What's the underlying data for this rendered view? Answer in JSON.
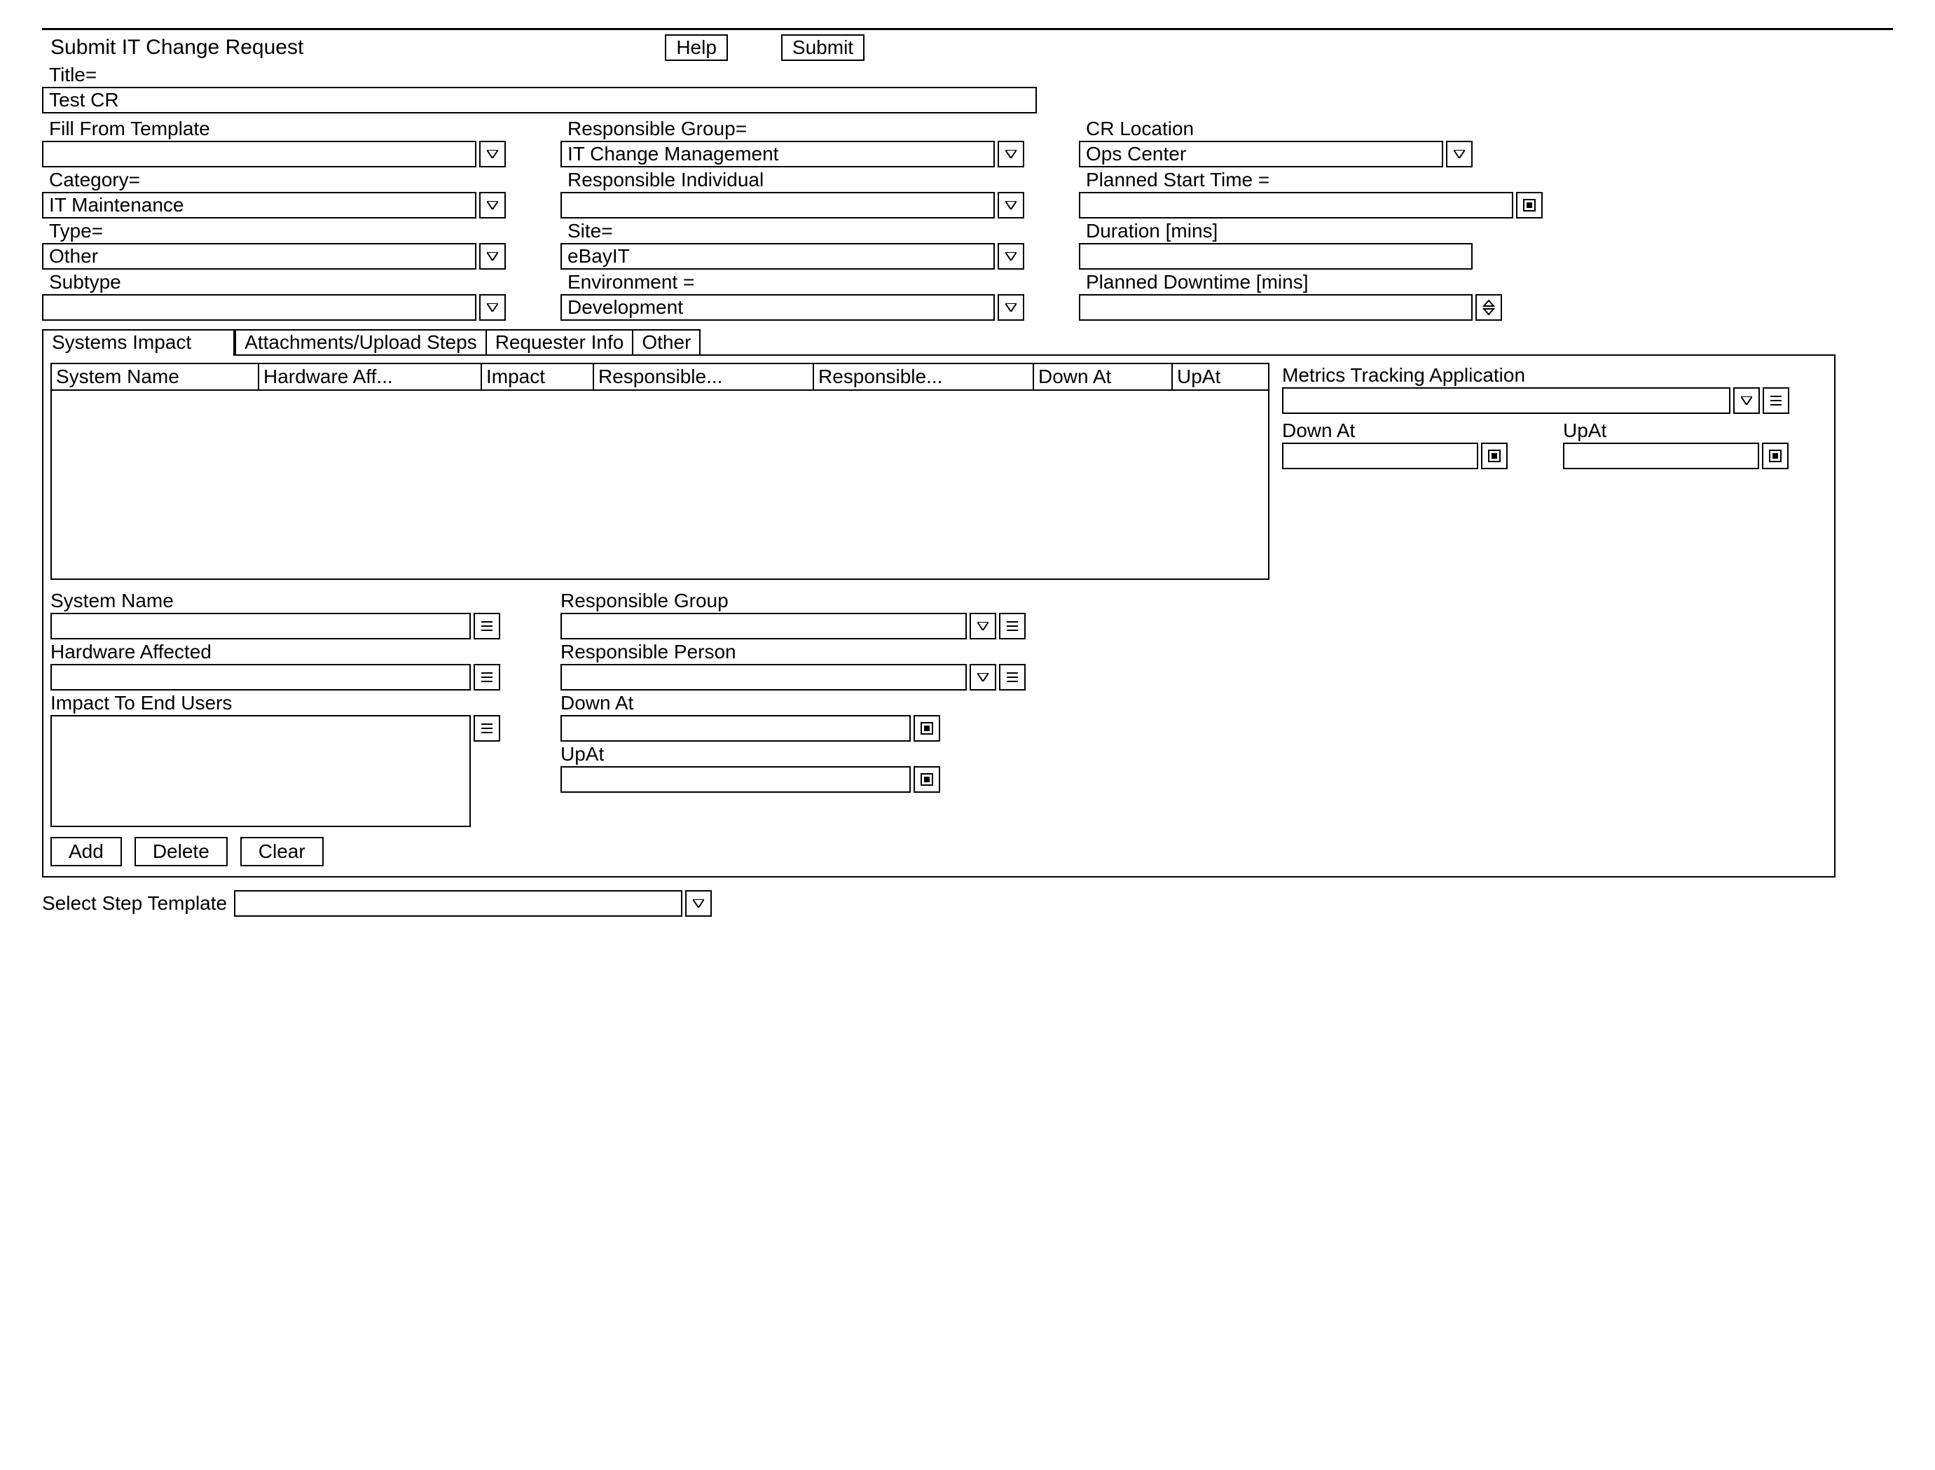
{
  "header": {
    "title": "Submit IT Change Request",
    "help_label": "Help",
    "submit_label": "Submit"
  },
  "title": {
    "label": "Title=",
    "value": "Test CR"
  },
  "col1": {
    "fill_template_label": "Fill From Template",
    "fill_template_value": "",
    "category_label": "Category=",
    "category_value": "IT Maintenance",
    "type_label": "Type=",
    "type_value": "Other",
    "subtype_label": "Subtype",
    "subtype_value": ""
  },
  "col2": {
    "resp_group_label": "Responsible Group=",
    "resp_group_value": "IT Change Management",
    "resp_indiv_label": "Responsible Individual",
    "resp_indiv_value": "",
    "site_label": "Site=",
    "site_value": "eBayIT",
    "env_label": "Environment =",
    "env_value": "Development"
  },
  "col3": {
    "cr_loc_label": "CR Location",
    "cr_loc_value": "Ops Center",
    "planned_start_label": "Planned Start Time =",
    "planned_start_value": "",
    "duration_label": "Duration [mins]",
    "duration_value": "",
    "planned_down_label": "Planned Downtime [mins]",
    "planned_down_value": ""
  },
  "tabs": {
    "t1": "Systems Impact",
    "t2": "Attachments/Upload Steps",
    "t3": "Requester Info",
    "t4": "Other"
  },
  "table_headers": {
    "h1": "System Name",
    "h2": "Hardware Aff...",
    "h3": "Impact",
    "h4": "Responsible...",
    "h5": "Responsible...",
    "h6": "Down At",
    "h7": "UpAt"
  },
  "metrics": {
    "label": "Metrics Tracking Application",
    "value": "",
    "down_at_label": "Down At",
    "down_at_value": "",
    "up_at_label": "UpAt",
    "up_at_value": ""
  },
  "detail": {
    "system_name_label": "System Name",
    "system_name_value": "",
    "hw_aff_label": "Hardware Affected",
    "hw_aff_value": "",
    "impact_label": "Impact To End Users",
    "impact_value": "",
    "resp_group_label": "Responsible Group",
    "resp_group_value": "",
    "resp_person_label": "Responsible Person",
    "resp_person_value": "",
    "down_at_label": "Down At",
    "down_at_value": "",
    "up_at_label": "UpAt",
    "up_at_value": ""
  },
  "buttons": {
    "add": "Add",
    "delete": "Delete",
    "clear": "Clear"
  },
  "footer": {
    "select_step_label": "Select Step Template",
    "select_step_value": ""
  }
}
